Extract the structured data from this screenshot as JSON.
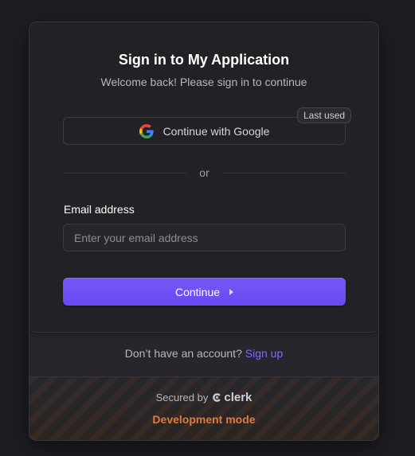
{
  "header": {
    "title": "Sign in to My Application",
    "subtitle": "Welcome back! Please sign in to continue"
  },
  "google": {
    "label": "Continue with Google",
    "badge": "Last used",
    "icon": "google-icon"
  },
  "divider": {
    "text": "or"
  },
  "email": {
    "label": "Email address",
    "placeholder": "Enter your email address",
    "value": ""
  },
  "continue": {
    "label": "Continue",
    "icon": "arrow-right-icon"
  },
  "signup": {
    "prompt": "Don’t have an account?",
    "link": "Sign up"
  },
  "footer": {
    "secured_by": "Secured by",
    "brand": "clerk",
    "dev_mode": "Development mode"
  },
  "colors": {
    "background": "#1d1d22",
    "card": "#212126",
    "primary": "#6c47ff",
    "link": "#7e6bff",
    "dev_mode": "#e2783a"
  }
}
